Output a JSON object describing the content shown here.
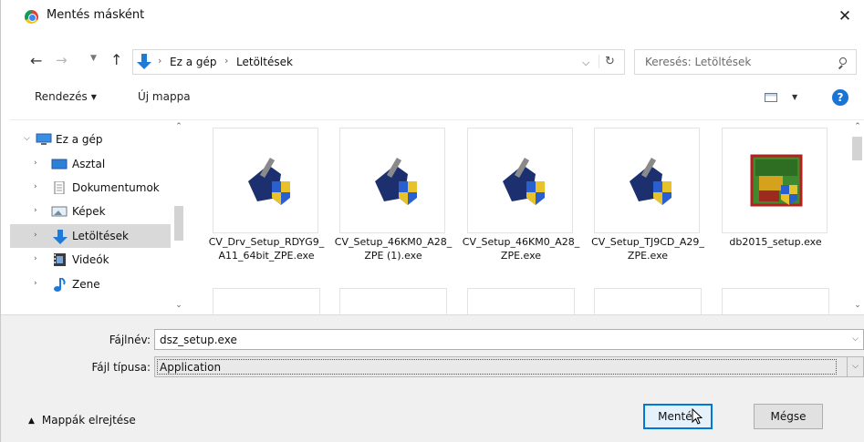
{
  "window": {
    "title": "Mentés másként",
    "close_glyph": "✕"
  },
  "address": {
    "breadcrumbs": [
      "Ez a gép",
      "Letöltések"
    ],
    "search_placeholder": "Keresés: Letöltések"
  },
  "toolbar": {
    "organize_label": "Rendezés",
    "new_folder_label": "Új mappa",
    "help_label": "?"
  },
  "nav_tree": [
    {
      "label": "Ez a gép",
      "expanded": true,
      "icon": "computer-icon"
    },
    {
      "label": "Asztal",
      "icon": "desktop-icon"
    },
    {
      "label": "Dokumentumok",
      "icon": "documents-icon"
    },
    {
      "label": "Képek",
      "icon": "pictures-icon"
    },
    {
      "label": "Letöltések",
      "icon": "downloads-icon",
      "selected": true
    },
    {
      "label": "Videók",
      "icon": "videos-icon"
    },
    {
      "label": "Zene",
      "icon": "music-icon"
    }
  ],
  "files": [
    {
      "name": "CV_Drv_Setup_RDYG9_A11_64bit_ZPE.exe",
      "icon": "setup-installer-icon"
    },
    {
      "name": "CV_Setup_46KM0_A28_ZPE (1).exe",
      "icon": "setup-installer-icon"
    },
    {
      "name": "CV_Setup_46KM0_A28_ZPE.exe",
      "icon": "setup-installer-icon"
    },
    {
      "name": "CV_Setup_TJ9CD_A29_ZPE.exe",
      "icon": "setup-installer-icon"
    },
    {
      "name": "db2015_setup.exe",
      "icon": "dber-app-icon"
    }
  ],
  "form": {
    "filename_label": "Fájlnév:",
    "filename_value": "dsz_setup.exe",
    "filetype_label": "Fájl típusa:",
    "filetype_value": "Application"
  },
  "footer": {
    "hide_folders_label": "Mappák elrejtése",
    "save_label": "Mentés",
    "cancel_label": "Mégse"
  },
  "colors": {
    "accent": "#0078d7",
    "download_arrow": "#1e7ad8",
    "help": "#1a74d4",
    "selected_row": "#d9d9d9"
  }
}
